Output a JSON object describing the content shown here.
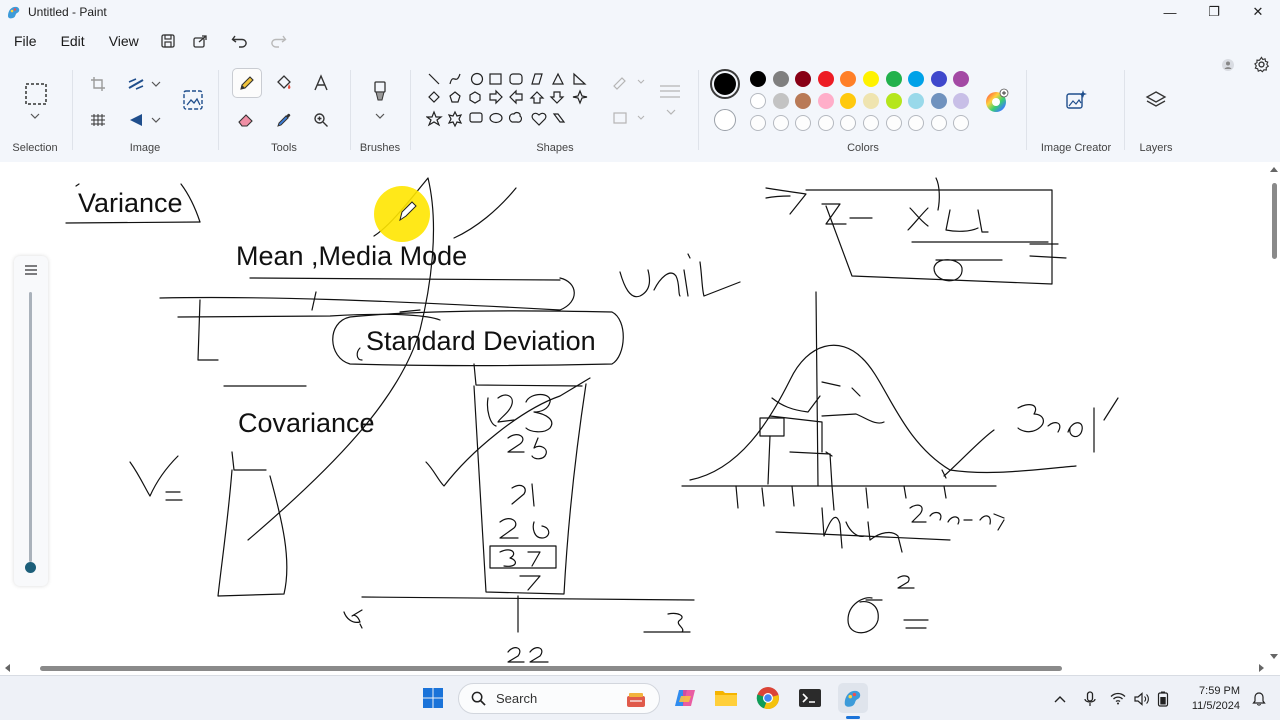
{
  "window": {
    "title": "Untitled - Paint",
    "minimize_glyph": "—",
    "maximize_glyph": "❐",
    "close_glyph": "✕"
  },
  "menu": {
    "file": "File",
    "edit": "Edit",
    "view": "View"
  },
  "ribbon": {
    "groups": {
      "selection": "Selection",
      "image": "Image",
      "tools": "Tools",
      "brushes": "Brushes",
      "shapes": "Shapes",
      "colors": "Colors",
      "image_creator": "Image Creator",
      "layers": "Layers"
    },
    "palette": {
      "primary": "#000000",
      "secondary": "#ffffff",
      "row1": [
        "#000000",
        "#7f7f7f",
        "#880015",
        "#ed1c24",
        "#ff7f27",
        "#fff200",
        "#22b14c",
        "#00a2e8",
        "#3f48cc",
        "#a349a4"
      ],
      "row2": [
        "#ffffff",
        "#c3c3c3",
        "#b97a57",
        "#ffaec9",
        "#ffc90e",
        "#efe4b0",
        "#b5e61d",
        "#99d9ea",
        "#7092be",
        "#c8bfe7"
      ]
    }
  },
  "canvas": {
    "texts": {
      "variance": "Variance",
      "mean_media_mode": "Mean ,Media Mode",
      "standard_deviation": "Standard Deviation",
      "covariance": "Covariance"
    }
  },
  "taskbar": {
    "search_label": "Search",
    "time": "7:59 PM",
    "date": "11/5/2024"
  },
  "icons": {
    "start": "windows-start-icon",
    "search": "search-icon",
    "copilot": "copilot-icon",
    "explorer": "file-explorer-icon",
    "chrome": "chrome-icon",
    "terminal": "terminal-icon",
    "paint": "paint-icon"
  }
}
